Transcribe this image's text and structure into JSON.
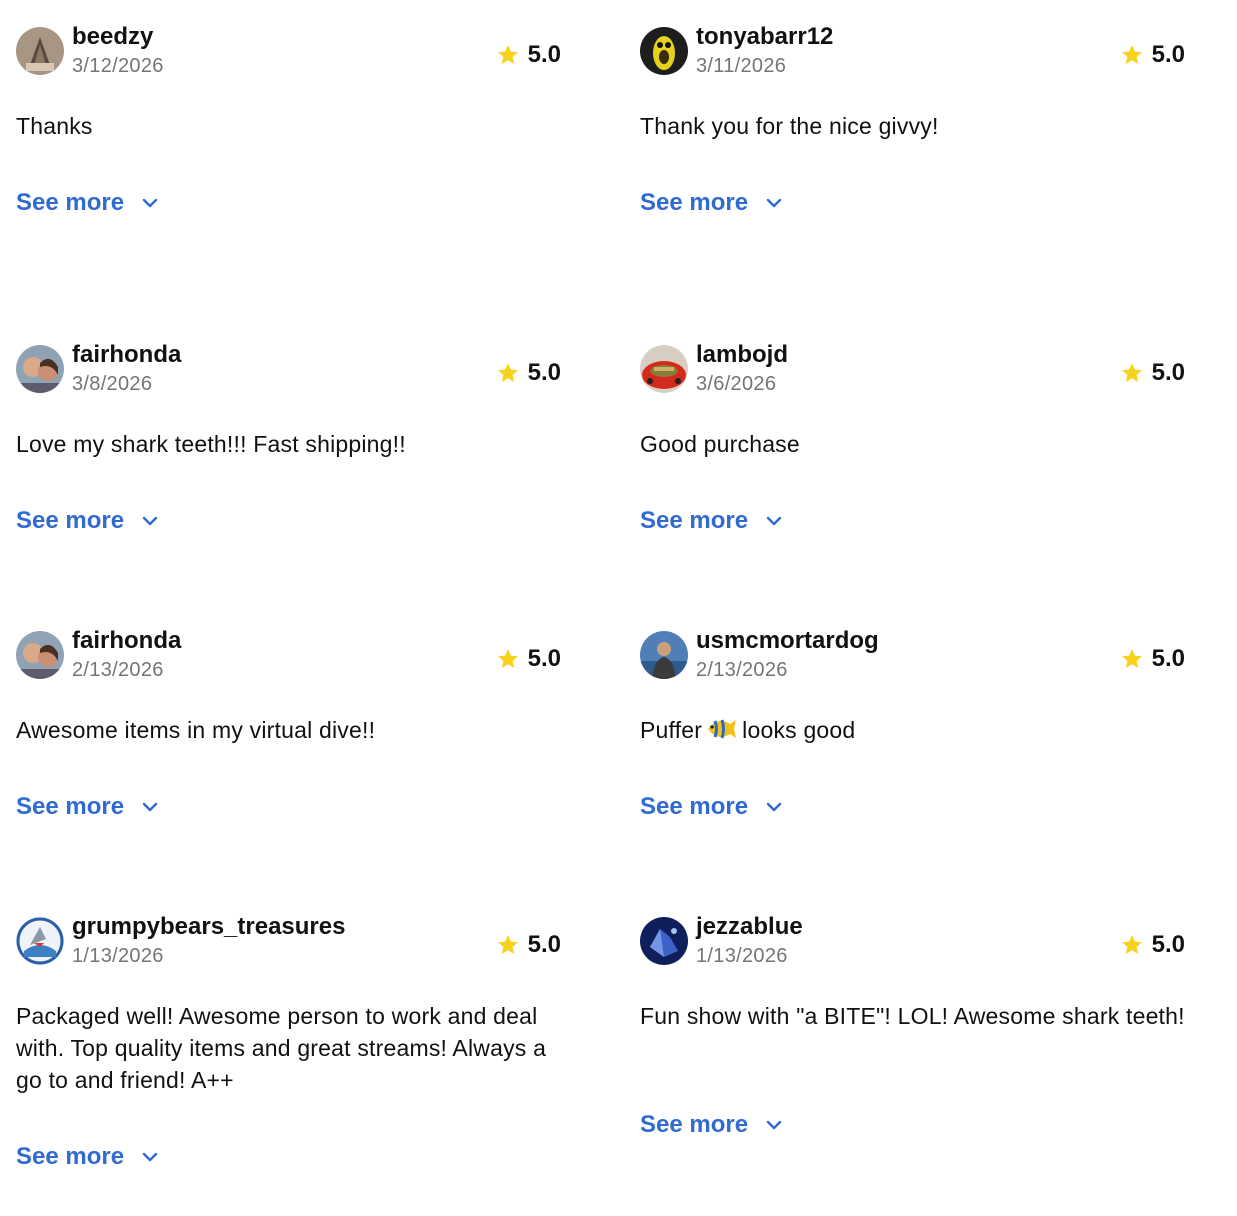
{
  "see_more_label": "See more",
  "colors": {
    "link": "#2f6bd0",
    "star": "#f7d21c",
    "date": "#757575"
  },
  "reviews": [
    {
      "username": "beedzy",
      "date": "3/12/2026",
      "rating": "5.0",
      "text": "Thanks",
      "avatar": "shark-tooth-avatar"
    },
    {
      "username": "tonyabarr12",
      "date": "3/11/2026",
      "rating": "5.0",
      "text": "Thank you for the nice givvy!",
      "avatar": "yellow-creature-avatar"
    },
    {
      "username": "fairhonda",
      "date": "3/8/2026",
      "rating": "5.0",
      "text": "Love my shark teeth!!! Fast shipping!!",
      "avatar": "couple-photo-avatar"
    },
    {
      "username": "lambojd",
      "date": "3/6/2026",
      "rating": "5.0",
      "text": "Good purchase",
      "avatar": "red-car-avatar"
    },
    {
      "username": "fairhonda",
      "date": "2/13/2026",
      "rating": "5.0",
      "text": "Awesome items in my virtual dive!!",
      "avatar": "couple-photo-avatar"
    },
    {
      "username": "usmcmortardog",
      "date": "2/13/2026",
      "rating": "5.0",
      "text_before": "Puffer",
      "text_after": "looks good",
      "emoji": "tropical-fish-emoji",
      "avatar": "person-outdoors-avatar"
    },
    {
      "username": "grumpybears_treasures",
      "date": "1/13/2026",
      "rating": "5.0",
      "text": "Packaged well! Awesome person to work and deal with. Top quality items and great streams! Always a go to and friend! A++",
      "avatar": "shark-cartoon-avatar"
    },
    {
      "username": "jezzablue",
      "date": "1/13/2026",
      "rating": "5.0",
      "text": "Fun show with \"a BITE\"! LOL! Awesome shark teeth!",
      "avatar": "blue-crystal-avatar"
    }
  ]
}
